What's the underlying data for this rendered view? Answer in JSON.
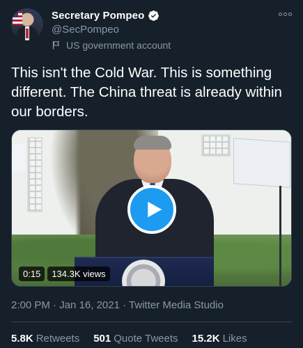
{
  "author": {
    "display_name": "Secretary Pompeo",
    "handle": "@SecPompeo",
    "label": "US government account",
    "verified_icon": "verified-badge-icon",
    "account_label_icon": "flag-icon"
  },
  "tweet": {
    "text": "This isn't the Cold War. This is something different. The China threat is already within our borders."
  },
  "video": {
    "duration": "0:15",
    "views": "134.3K views",
    "play_icon": "play-icon"
  },
  "meta": {
    "time": "2:00 PM",
    "separator": "·",
    "date": "Jan 16, 2021",
    "source": "Twitter Media Studio"
  },
  "stats": {
    "retweets_count": "5.8K",
    "retweets_label": "Retweets",
    "quotes_count": "501",
    "quotes_label": "Quote Tweets",
    "likes_count": "15.2K",
    "likes_label": "Likes"
  },
  "colors": {
    "background": "#15202b",
    "accent": "#1d9bf0",
    "secondary_text": "#8b98a5",
    "divider": "#38444d"
  }
}
